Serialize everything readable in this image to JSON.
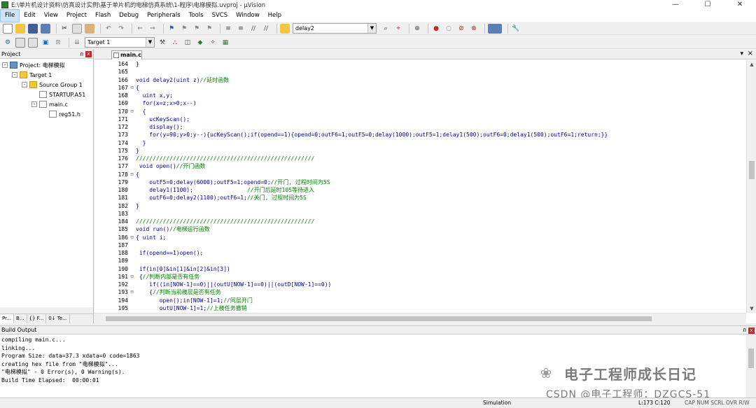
{
  "window": {
    "title": "E:\\单片机设计资料\\仿真设计实例\\基于单片机的电梯仿真系统\\1-程序\\电梯模拟.uvproj - µVision",
    "min_label": "—",
    "max_label": "☐",
    "close_label": "✕"
  },
  "menu": [
    "File",
    "Edit",
    "View",
    "Project",
    "Flash",
    "Debug",
    "Peripherals",
    "Tools",
    "SVCS",
    "Window",
    "Help"
  ],
  "toolbar": {
    "find_combo_value": "delay2",
    "target_combo_value": "Target 1"
  },
  "project_pane": {
    "title": "Project",
    "pin": "ᴨ",
    "close": "x",
    "tree": [
      {
        "label": "Project: 电梯模拟",
        "level": 0,
        "icon": "project-icon",
        "exp": "-"
      },
      {
        "label": "Target 1",
        "level": 1,
        "icon": "folder-icon",
        "exp": "-"
      },
      {
        "label": "Source Group 1",
        "level": 2,
        "icon": "folder-icon",
        "exp": "-"
      },
      {
        "label": "STARTUP.A51",
        "level": 3,
        "icon": "file-icon",
        "exp": ""
      },
      {
        "label": "main.c",
        "level": 3,
        "icon": "file-icon",
        "exp": "-"
      },
      {
        "label": "reg51.h",
        "level": 4,
        "icon": "file-icon",
        "exp": ""
      }
    ],
    "tabs": [
      "Pr...",
      "B...",
      "{} F...",
      "0↓ Te..."
    ]
  },
  "editor": {
    "tab_label": "main.c",
    "lines": [
      {
        "n": "164",
        "f": "",
        "t": [
          [
            "plain",
            "}"
          ]
        ]
      },
      {
        "n": "165",
        "f": "",
        "t": []
      },
      {
        "n": "166",
        "f": "",
        "t": [
          [
            "kw",
            "void delay2(uint z)"
          ],
          [
            "cm",
            "//延时函数"
          ]
        ]
      },
      {
        "n": "167",
        "f": "⊟",
        "t": [
          [
            "kw",
            "{"
          ]
        ]
      },
      {
        "n": "168",
        "f": "",
        "t": [
          [
            "kw",
            "  uint x,y;"
          ]
        ]
      },
      {
        "n": "169",
        "f": "",
        "t": [
          [
            "kw",
            "  for(x=z;x>0;x--)"
          ]
        ]
      },
      {
        "n": "170",
        "f": "⊟",
        "t": [
          [
            "kw",
            "  {"
          ]
        ]
      },
      {
        "n": "171",
        "f": "",
        "t": [
          [
            "kw",
            "    ucKeyScan();"
          ]
        ]
      },
      {
        "n": "172",
        "f": "",
        "t": [
          [
            "kw",
            "    display();"
          ]
        ]
      },
      {
        "n": "173",
        "f": "",
        "t": [
          [
            "kw",
            "    for(y=90;y>0;y--){ucKeyScan();if(opend==1){opend=0;outF6=1;outF5=0;delay(1000);outF5=1;delay1(500);outF6=0;delay1(500);outF6=1;return;}}"
          ]
        ]
      },
      {
        "n": "174",
        "f": "",
        "t": [
          [
            "kw",
            "  }"
          ]
        ]
      },
      {
        "n": "175",
        "f": "",
        "t": [
          [
            "kw",
            "}"
          ]
        ]
      },
      {
        "n": "176",
        "f": "",
        "t": [
          [
            "cm",
            "/////////////////////////////////////////////////////"
          ]
        ]
      },
      {
        "n": "177",
        "f": "",
        "t": [
          [
            "kw",
            " void open()"
          ],
          [
            "cm",
            "//开门函数"
          ]
        ]
      },
      {
        "n": "178",
        "f": "⊟",
        "t": [
          [
            "kw",
            "{"
          ]
        ]
      },
      {
        "n": "179",
        "f": "",
        "t": [
          [
            "kw",
            "    outF5=0;delay(6000);outF5=1;opend=0;"
          ],
          [
            "cm",
            "//开门, 过程时间为5S"
          ]
        ]
      },
      {
        "n": "180",
        "f": "",
        "t": [
          [
            "kw",
            "    delay1(1100);                "
          ],
          [
            "cm",
            "//开门后延时10S等待进入"
          ]
        ]
      },
      {
        "n": "181",
        "f": "",
        "t": [
          [
            "kw",
            "    outF6=0;delay2(1100);outF6=1;"
          ],
          [
            "cm",
            "//关门, 过程时间为5S"
          ]
        ]
      },
      {
        "n": "182",
        "f": "",
        "t": [
          [
            "kw",
            "}"
          ]
        ]
      },
      {
        "n": "183",
        "f": "",
        "t": []
      },
      {
        "n": "184",
        "f": "",
        "t": [
          [
            "cm",
            "/////////////////////////////////////////////////////"
          ]
        ]
      },
      {
        "n": "185",
        "f": "",
        "t": [
          [
            "kw",
            "void run()"
          ],
          [
            "cm",
            "//电梯运行函数"
          ]
        ]
      },
      {
        "n": "186",
        "f": "⊟",
        "t": [
          [
            "kw",
            "{ uint i;"
          ]
        ]
      },
      {
        "n": "187",
        "f": "",
        "t": []
      },
      {
        "n": "188",
        "f": "",
        "t": [
          [
            "kw",
            " if(opend==1)open();"
          ]
        ]
      },
      {
        "n": "189",
        "f": "",
        "t": []
      },
      {
        "n": "190",
        "f": "",
        "t": [
          [
            "kw",
            " if(in[0]&in[1]&in[2]&in[3])"
          ]
        ]
      },
      {
        "n": "191",
        "f": "⊟",
        "t": [
          [
            "kw",
            " {"
          ],
          [
            "cm",
            "//判断内部是否有任务"
          ]
        ]
      },
      {
        "n": "192",
        "f": "",
        "t": [
          [
            "kw",
            "    if((in[NOW-1]==0)||(outU[NOW-1]==0)||(outD[NOW-1]==0))"
          ]
        ]
      },
      {
        "n": "193",
        "f": "⊟",
        "t": [
          [
            "kw",
            "    {"
          ],
          [
            "cm",
            "//判断当前楼层是否有任务"
          ]
        ]
      },
      {
        "n": "194",
        "f": "",
        "t": [
          [
            "kw",
            "       open();in[NOW-1]=1;"
          ],
          [
            "cm",
            "//同层开门"
          ]
        ]
      },
      {
        "n": "195",
        "f": "",
        "t": [
          [
            "kw",
            "       outU[NOW-1]=1;"
          ],
          [
            "cm",
            "//上楼任务撤销"
          ]
        ]
      }
    ]
  },
  "build": {
    "title": "Build Output",
    "lines": [
      "compiling main.c...",
      "linking...",
      "Program Size: data=37.3 xdata=0 code=1863",
      "creating hex file from \"电梯模拟\"...",
      "\"电梯模拟\" - 0 Error(s), 0 Warning(s).",
      "Build Time Elapsed:  00:00:01"
    ]
  },
  "watermark": {
    "main": "电子工程师成长日记",
    "sub": "CSDN @电子工程师：DZGCS-51"
  },
  "status": {
    "mode": "Simulation",
    "position": "L:173 C:120",
    "keys": "CAP  NUM  SCRL  OVR  R/W"
  }
}
